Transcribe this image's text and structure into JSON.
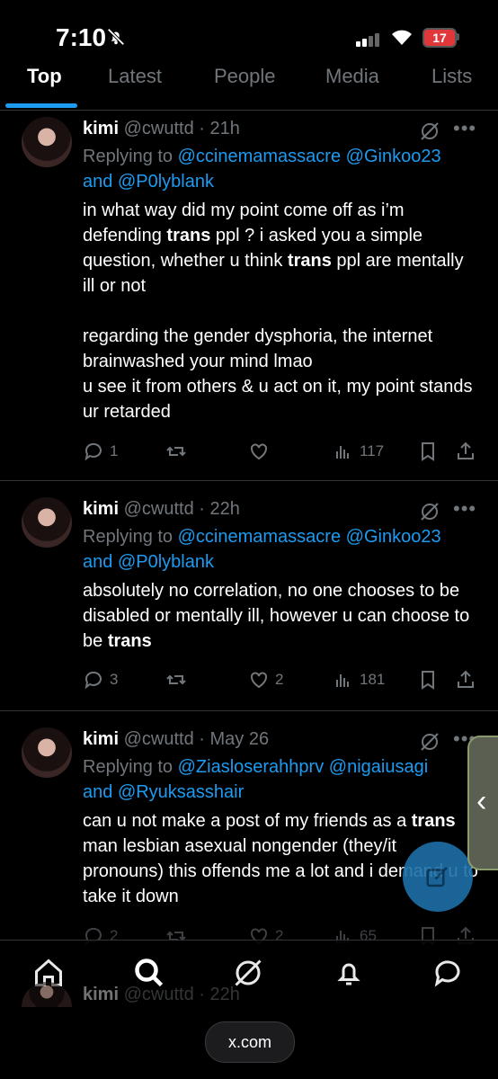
{
  "status_bar": {
    "time": "7:10",
    "battery": "17"
  },
  "tabs": [
    "Top",
    "Latest",
    "People",
    "Media",
    "Lists"
  ],
  "tweets": [
    {
      "name": "kimi",
      "handle": "@cwuttd",
      "sep": "·",
      "time": "21h",
      "replying_prefix": "Replying to ",
      "mention1": "@ccinemamassacre",
      "mention2": "@Ginkoo23",
      "and": "and ",
      "mention3": "@P0lyblank",
      "p1a": "in what way did my point come off as i’m defending ",
      "p1b": "trans",
      "p1c": " ppl ? i asked you a simple question, whether u think ",
      "p1d": "trans",
      "p1e": " ppl are mentally ill or not",
      "p2": "regarding the gender dysphoria, the internet brainwashed your mind lmao\nu see it from others & u act on it, my point stands ur retarded",
      "replies": "1",
      "reposts": "",
      "likes": "",
      "views": "117"
    },
    {
      "name": "kimi",
      "handle": "@cwuttd",
      "sep": "·",
      "time": "22h",
      "replying_prefix": "Replying to ",
      "mention1": "@ccinemamassacre",
      "mention2": "@Ginkoo23",
      "and": "and ",
      "mention3": "@P0lyblank",
      "p1a": "absolutely no correlation, no one chooses to be disabled or mentally ill, however u can choose to be ",
      "p1b": "trans",
      "replies": "3",
      "reposts": "",
      "likes": "2",
      "views": "181"
    },
    {
      "name": "kimi",
      "handle": "@cwuttd",
      "sep": "·",
      "time": "May 26",
      "replying_prefix": "Replying to ",
      "mention1": "@Ziasloserahhprv",
      "mention2": "@nigaiusagi",
      "and": "and ",
      "mention3": "@Ryuksasshair",
      "p1a": "can u not make a post of my friends as a ",
      "p1b": "trans",
      "p1c": " man lesbian asexual nongender (they/it pronouns) this offends me a lot and i demand u to take it down",
      "replies": "2",
      "reposts": "",
      "likes": "2",
      "views": "65"
    },
    {
      "name": "kimi",
      "handle": "@cwuttd",
      "sep": "·",
      "time": "22h"
    }
  ],
  "url_bar": "x.com",
  "colors": {
    "accent": "#1d9bf0",
    "muted": "#71767b",
    "divider": "#2f3336"
  }
}
